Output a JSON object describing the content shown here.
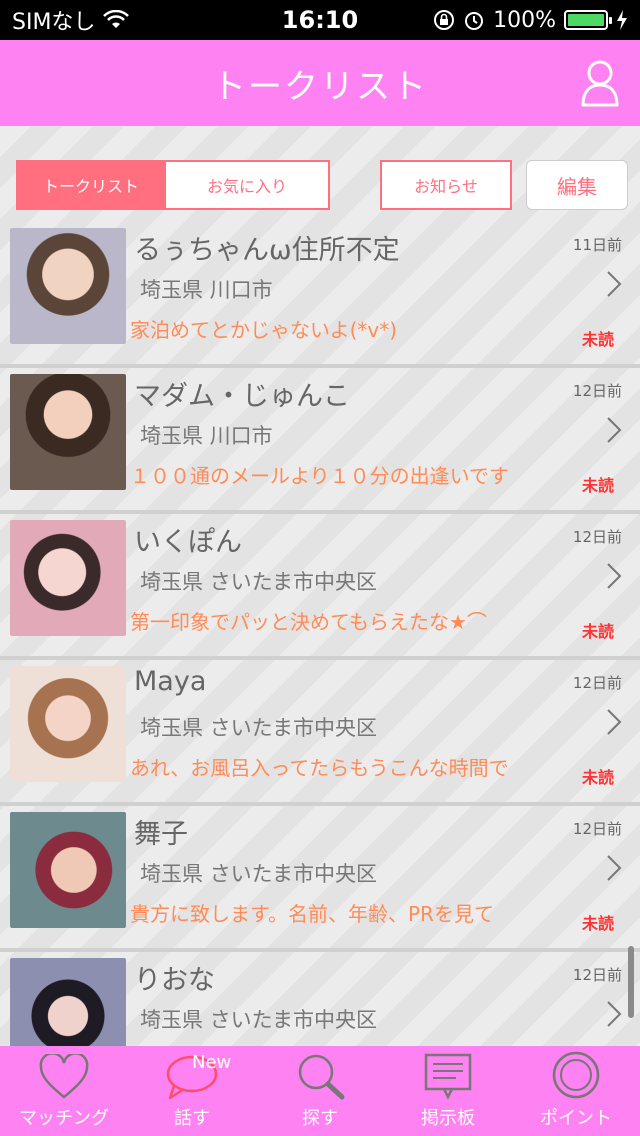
{
  "status": {
    "carrier": "SIMなし",
    "time": "16:10",
    "battery": "100%"
  },
  "header": {
    "title": "トークリスト"
  },
  "tabs": {
    "talk": "トークリスト",
    "favorites": "お気に入り",
    "notice": "お知らせ",
    "edit": "編集"
  },
  "colors": {
    "brand": "#ff82f2",
    "accent": "#ff6f80",
    "message": "#ff8c57",
    "unread": "#ff3333"
  },
  "list": [
    {
      "name": "るぅちゃんω住所不定",
      "date": "11日前",
      "place": "埼玉県 川口市",
      "message": "家泊めてとかじゃないよ(*v*)",
      "status": "未読"
    },
    {
      "name": "マダム・じゅんこ",
      "date": "12日前",
      "place": "埼玉県 川口市",
      "message": "１００通のメールより１０分の出逢いです",
      "status": "未読"
    },
    {
      "name": "いくぽん",
      "date": "12日前",
      "place": "埼玉県 さいたま市中央区",
      "message": "第一印象でパッと決めてもらえたな★⌒",
      "status": "未読"
    },
    {
      "name": "Maya",
      "date": "12日前",
      "place": "埼玉県 さいたま市中央区",
      "message": "あれ、お風呂入ってたらもうこんな時間で",
      "status": "未読"
    },
    {
      "name": "舞子",
      "date": "12日前",
      "place": "埼玉県 さいたま市中央区",
      "message": "貴方に致します。名前、年齢、PRを見て",
      "status": "未読"
    },
    {
      "name": "りおな",
      "date": "12日前",
      "place": "埼玉県 さいたま市中央区",
      "message": "",
      "status": ""
    }
  ],
  "tabbar": {
    "matching": "マッチング",
    "talk": "話す",
    "talk_badge": "New",
    "search": "探す",
    "board": "掲示板",
    "points": "ポイント"
  }
}
